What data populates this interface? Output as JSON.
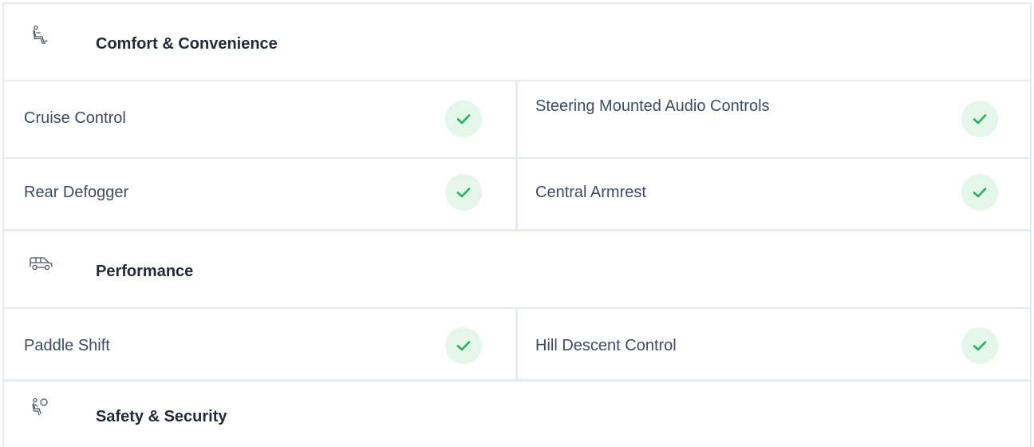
{
  "sections": [
    {
      "title": "Comfort & Convenience",
      "icon": "seat-icon",
      "rows": [
        {
          "left": {
            "label": "Cruise Control",
            "available": true
          },
          "right": {
            "label": "Steering Mounted Audio Controls",
            "available": true
          }
        },
        {
          "left": {
            "label": "Rear Defogger",
            "available": true
          },
          "right": {
            "label": "Central Armrest",
            "available": true
          }
        }
      ]
    },
    {
      "title": "Performance",
      "icon": "car-icon",
      "rows": [
        {
          "left": {
            "label": "Paddle Shift",
            "available": true
          },
          "right": {
            "label": "Hill Descent Control",
            "available": true
          }
        }
      ]
    },
    {
      "title": "Safety & Security",
      "icon": "airbag-icon",
      "rows": []
    }
  ],
  "colors": {
    "check_bg": "#e4f6ea",
    "check_mark": "#22b35e",
    "divider": "#e6ebf1",
    "title": "#232b38",
    "label": "#3e4c63"
  }
}
